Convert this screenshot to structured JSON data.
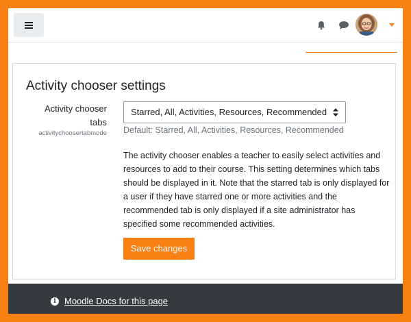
{
  "navbar": {
    "menu_icon": "hamburger-icon",
    "notifications_icon": "bell-icon",
    "messages_icon": "chat-icon",
    "user_menu_icon": "chevron-down-icon"
  },
  "settings": {
    "title": "Activity chooser settings",
    "setting": {
      "label": "Activity chooser tabs",
      "code": "activitychoosertabmode",
      "selected_value": "Starred, All, Activities, Resources, Recommended",
      "default_text": "Default: Starred, All, Activities, Resources, Recommended",
      "description": "The activity chooser enables a teacher to easily select activities and resources to add to their course. This setting determines which tabs should be displayed in it. Note that the starred tab is only displayed for a user if they have starred one or more activities and the recommended tab is only displayed if a site administrator has specified some recommended activities."
    },
    "save_label": "Save changes"
  },
  "footer": {
    "docs_link": "Moodle Docs for this page",
    "info_icon": "info-icon"
  },
  "colors": {
    "accent": "#f98012",
    "footer_bg": "#343a40"
  }
}
